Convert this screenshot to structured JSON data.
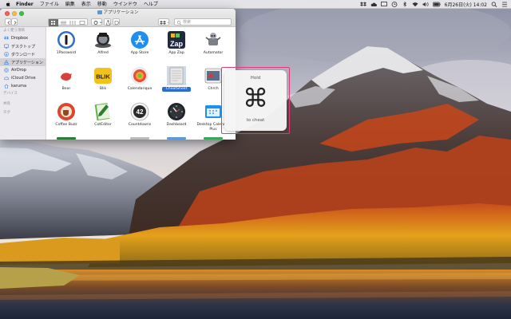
{
  "menubar": {
    "app_name": "Finder",
    "items": [
      "ファイル",
      "編集",
      "表示",
      "移動",
      "ウインドウ",
      "ヘルプ"
    ],
    "clock": "6月26日(火) 14:02"
  },
  "window": {
    "title": "アプリケーション",
    "search_placeholder": "検索"
  },
  "sidebar": {
    "favorites_header": "よく使う項目",
    "favorites": [
      {
        "label": "Dropbox",
        "icon": "dropbox-icon"
      },
      {
        "label": "デスクトップ",
        "icon": "desktop-icon"
      },
      {
        "label": "ダウンロード",
        "icon": "downloads-icon"
      },
      {
        "label": "アプリケーション",
        "icon": "applications-icon",
        "selected": true
      },
      {
        "label": "AirDrop",
        "icon": "airdrop-icon"
      },
      {
        "label": "iCloud Drive",
        "icon": "icloud-icon"
      },
      {
        "label": "karuma",
        "icon": "home-icon"
      }
    ],
    "devices_header": "デバイス",
    "shared_header": "共有",
    "tags_header": "タグ"
  },
  "apps": [
    {
      "label": "1Password",
      "icon": "1password-icon"
    },
    {
      "label": "Alfred",
      "icon": "alfred-icon"
    },
    {
      "label": "App Store",
      "icon": "app-store-icon"
    },
    {
      "label": "App Zap",
      "icon": "app-zap-icon"
    },
    {
      "label": "Automator",
      "icon": "automator-icon"
    },
    {
      "label": "Bear",
      "icon": "bear-icon"
    },
    {
      "label": "Blik",
      "icon": "blik-icon"
    },
    {
      "label": "Calendarique",
      "icon": "calendarique-icon"
    },
    {
      "label": "CheatSheet",
      "icon": "cheatsheet-icon",
      "selected": true
    },
    {
      "label": "Chrch",
      "icon": "chrch-icon"
    },
    {
      "label": "Coffee Buzz",
      "icon": "coffee-buzz-icon"
    },
    {
      "label": "CotEditor",
      "icon": "coteditor-icon"
    },
    {
      "label": "Countdowns",
      "icon": "countdowns-icon"
    },
    {
      "label": "Dashboard",
      "icon": "dashboard-icon"
    },
    {
      "label": "Desktop Calendar Plus",
      "icon": "desktop-calendar-icon"
    }
  ],
  "app_zap_text": "Zap",
  "blik_text": "BLIK",
  "countdown_text": "42",
  "cheatsheet": {
    "hold": "Hold",
    "symbol": "⌘",
    "to_cheat": "to cheat"
  },
  "colors": {
    "highlight_outline": "#e53a7a",
    "selection_blue": "#2a6ccf"
  }
}
